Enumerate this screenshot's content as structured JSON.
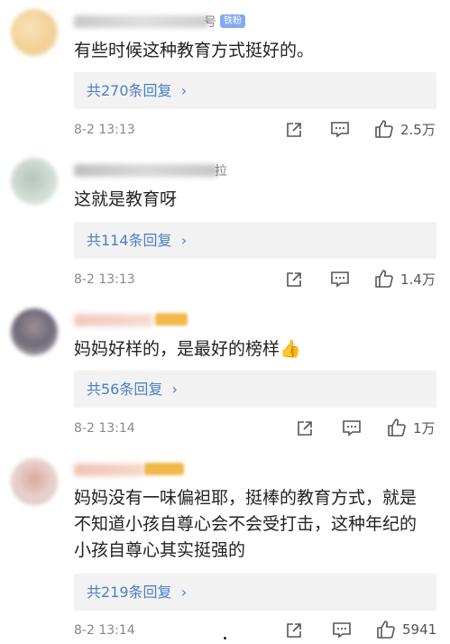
{
  "comments": [
    {
      "user_visible_suffix": "号",
      "badge": "铁粉",
      "text": "有些时候这种教育方式挺好的。",
      "reply_label": "共270条回复",
      "time": "8-2 13:13",
      "likes": "2.5万"
    },
    {
      "user_visible_suffix": "拉",
      "text": "这就是教育呀",
      "reply_label": "共114条回复",
      "time": "8-2 13:13",
      "likes": "1.4万"
    },
    {
      "text": "妈妈好样的，是最好的榜样👍",
      "reply_label": "共56条回复",
      "time": "8-2 13:14",
      "likes": "1万"
    },
    {
      "text_lines": [
        "妈妈没有一味偏袒耶，挺棒的教育方式，就是",
        "不知道小孩自尊心会不会受打击，这种年纪的",
        "小孩自尊心其实挺强的"
      ],
      "reply_label": "共219条回复",
      "time": "8-2 13:14",
      "likes": "5941"
    }
  ],
  "icons": {
    "share": "share-icon",
    "comment": "comment-icon",
    "like": "thumbs-up-icon",
    "reply_arrow": "chevron-right-icon"
  },
  "colors": {
    "link": "#4a7fc4",
    "badge": "#84a9f0",
    "reply_bg": "#f2f2f2",
    "meta": "#888888"
  }
}
